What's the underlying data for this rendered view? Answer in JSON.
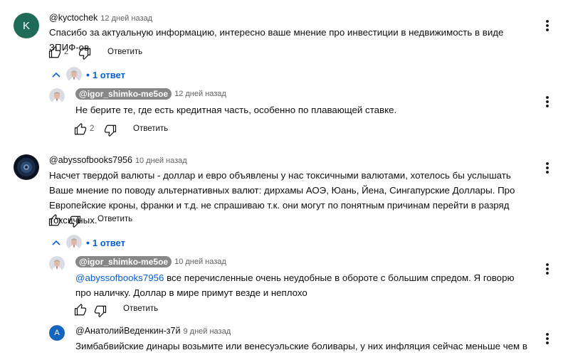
{
  "comments": [
    {
      "avatar_letter": "K",
      "author": "@kyctochek",
      "time": "12 дней назад",
      "text": "Спасибо за актуальную информацию, интересно ваше мнение про инвестиции в недвижимость в виде ЗПИФ-ов",
      "likes": "2",
      "reply_label": "Ответить",
      "replies_toggle": "1 ответ",
      "reply": {
        "author": "@igor_shimko-me5oe",
        "time": "12 дней назад",
        "text": "Не берите те, где есть кредитная часть, особенно по плавающей ставке.",
        "likes": "2",
        "reply_label": "Ответить"
      }
    },
    {
      "author": "@abyssofbooks7956",
      "time": "10 дней назад",
      "text": "Насчет твердой валюты - доллар и евро объявлены у нас токсичными валютами, хотелось бы услышать Ваше мнение по поводу альтернативных валют: дирхамы АОЭ, Юань, Йена, Сингапурские Доллары. Про Европейские кроны, франки и т.д. не спрашиваю т.к. они могут по понятным причинам перейти в разряд токсичных.",
      "reply_label": "Ответить",
      "replies_toggle": "1 ответ",
      "reply": {
        "author": "@igor_shimko-me5oe",
        "time": "10 дней назад",
        "mention": "@abyssofbooks7956",
        "text": " все перечисленные очень неудобные в обороте с большим спредом. Я говорю про наличку. Доллар в мире примут везде и неплохо",
        "reply_label": "Ответить"
      }
    },
    {
      "avatar_letter": "A",
      "author": "@АнатолийВеденкин-з7й",
      "time": "9 дней назад",
      "text": "Зимбабвийские динары возьмите или венесуэльские боливары, у них инфляция сейчас меньше чем в"
    }
  ],
  "colors": {
    "avatar_k": "#1e6b57",
    "avatar_a": "#1565c0",
    "link": "#065fd4",
    "pill": "#888888"
  },
  "icons": [
    "like-icon",
    "dislike-icon",
    "more-vert-icon",
    "chevron-up-icon"
  ]
}
